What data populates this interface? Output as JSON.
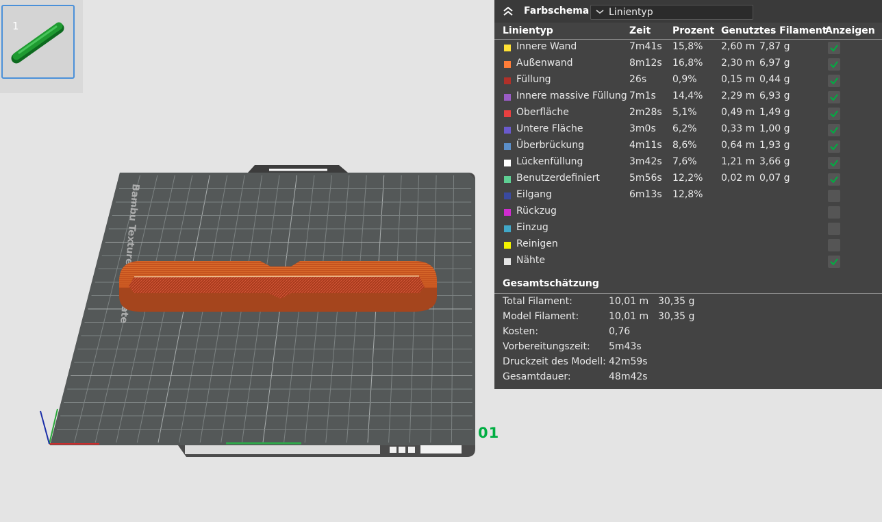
{
  "thumbnail": {
    "number": "1"
  },
  "plate": {
    "label": "01"
  },
  "panel": {
    "scheme_label": "Farbschema",
    "scheme_value": "Linientyp",
    "columns": {
      "type": "Linientyp",
      "time": "Zeit",
      "percent": "Prozent",
      "filament": "Genutztes Filament",
      "show": "Anzeigen"
    },
    "rows": [
      {
        "name": "Innere Wand",
        "time": "7m41s",
        "percent": "15,8%",
        "meters": "2,60 m",
        "grams": "7,87 g",
        "color": "#ffe135",
        "checked": true
      },
      {
        "name": "Außenwand",
        "time": "8m12s",
        "percent": "16,8%",
        "meters": "2,30 m",
        "grams": "6,97 g",
        "color": "#ff7d38",
        "checked": true
      },
      {
        "name": "Füllung",
        "time": "26s",
        "percent": "0,9%",
        "meters": "0,15 m",
        "grams": "0,44 g",
        "color": "#b03029",
        "checked": true
      },
      {
        "name": "Innere massive Füllung",
        "time": "7m1s",
        "percent": "14,4%",
        "meters": "2,29 m",
        "grams": "6,93 g",
        "color": "#9a5cc6",
        "checked": true
      },
      {
        "name": "Oberfläche",
        "time": "2m28s",
        "percent": "5,1%",
        "meters": "0,49 m",
        "grams": "1,49 g",
        "color": "#e84040",
        "checked": true
      },
      {
        "name": "Untere Fläche",
        "time": "3m0s",
        "percent": "6,2%",
        "meters": "0,33 m",
        "grams": "1,00 g",
        "color": "#6a5acd",
        "checked": true
      },
      {
        "name": "Überbrückung",
        "time": "4m11s",
        "percent": "8,6%",
        "meters": "0,64 m",
        "grams": "1,93 g",
        "color": "#5b8fc9",
        "checked": true
      },
      {
        "name": "Lückenfüllung",
        "time": "3m42s",
        "percent": "7,6%",
        "meters": "1,21 m",
        "grams": "3,66 g",
        "color": "#ffffff",
        "checked": true
      },
      {
        "name": "Benutzerdefiniert",
        "time": "5m56s",
        "percent": "12,2%",
        "meters": "0,02 m",
        "grams": "0,07 g",
        "color": "#5ecf93",
        "checked": true
      },
      {
        "name": "Eilgang",
        "time": "6m13s",
        "percent": "12,8%",
        "meters": "",
        "grams": "",
        "color": "#3a4aa0",
        "checked": false
      },
      {
        "name": "Rückzug",
        "time": "",
        "percent": "",
        "meters": "",
        "grams": "",
        "color": "#d12cd1",
        "checked": false
      },
      {
        "name": "Einzug",
        "time": "",
        "percent": "",
        "meters": "",
        "grams": "",
        "color": "#41a8c8",
        "checked": false
      },
      {
        "name": "Reinigen",
        "time": "",
        "percent": "",
        "meters": "",
        "grams": "",
        "color": "#f2f200",
        "checked": false
      },
      {
        "name": "Nähte",
        "time": "",
        "percent": "",
        "meters": "",
        "grams": "",
        "color": "#e6e6e6",
        "checked": true
      }
    ],
    "summary_title": "Gesamtschätzung",
    "summary": [
      {
        "label": "Total Filament:",
        "value": "10,01 m",
        "extra": "30,35 g"
      },
      {
        "label": "Model Filament:",
        "value": "10,01 m",
        "extra": "30,35 g"
      },
      {
        "label": "Kosten:",
        "value": "0,76",
        "extra": ""
      },
      {
        "label": "Vorbereitungszeit:",
        "value": "5m43s",
        "extra": ""
      },
      {
        "label": "Druckzeit des Modell:",
        "value": "42m59s",
        "extra": ""
      },
      {
        "label": "Gesamtdauer:",
        "value": "48m42s",
        "extra": ""
      }
    ],
    "colors": {
      "panel_bg": "#434343",
      "check": "#00ae42",
      "accent": "#4a90d9"
    }
  }
}
